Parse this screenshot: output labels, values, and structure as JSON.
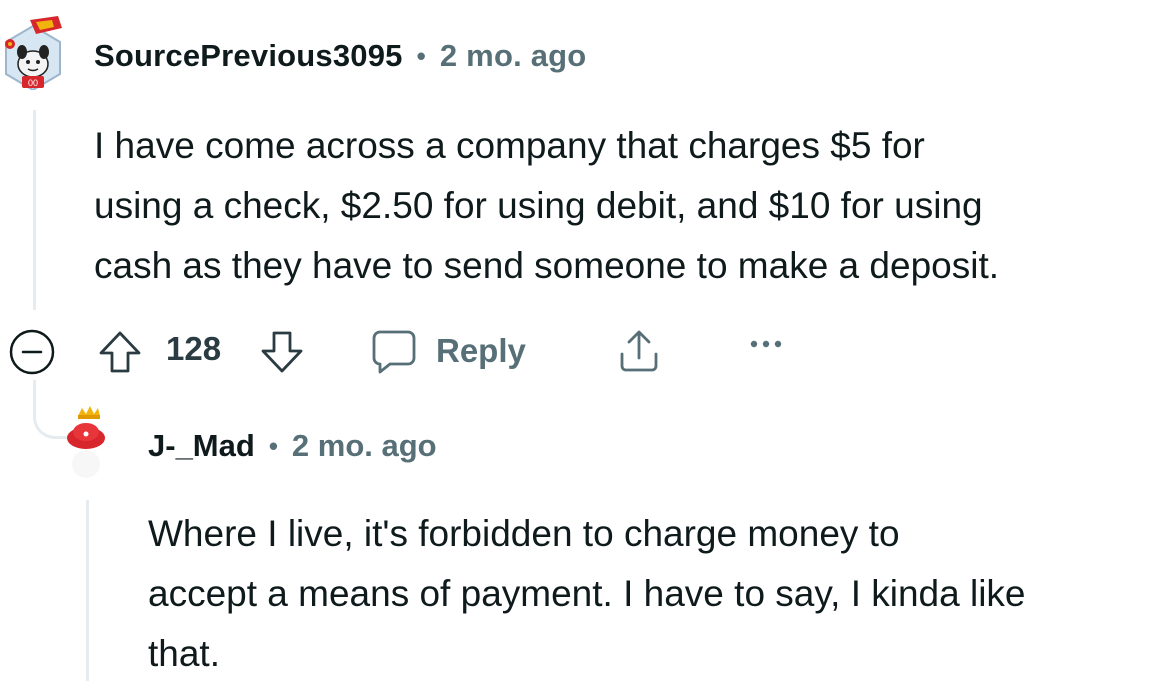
{
  "comments": [
    {
      "author": "SourcePrevious3095",
      "separator": "•",
      "time": "2 mo. ago",
      "body_lines": [
        "I have come across a company that charges $5 for",
        "using a check, $2.50 for using debit, and $10 for using",
        "cash as they have to send someone to make a deposit."
      ],
      "avatar_icon": "football-dog-avatar-icon",
      "actions": {
        "score": "128",
        "reply_label": "Reply"
      }
    },
    {
      "author": "J-_Mad",
      "separator": "•",
      "time": "2 mo. ago",
      "body_lines": [
        "Where I live, it's forbidden to charge money to",
        "accept a means of payment. I have to say, I kinda like",
        "that."
      ],
      "avatar_icon": "red-hat-avatar-icon"
    }
  ],
  "colors": {
    "text_primary": "#0f1a1c",
    "text_secondary": "#576f76",
    "thread_line": "#e5ebee",
    "avatar_red": "#d7262c",
    "avatar_gold": "#f2b40c"
  }
}
